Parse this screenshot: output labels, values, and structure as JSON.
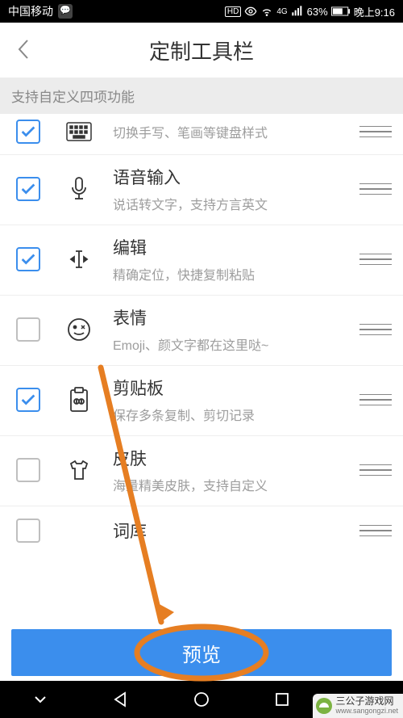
{
  "status": {
    "carrier": "中国移动",
    "hd": "HD",
    "network": "4G",
    "battery": "63%",
    "time": "晚上9:16"
  },
  "header": {
    "title": "定制工具栏"
  },
  "notice": "支持自定义四项功能",
  "items": [
    {
      "title": "",
      "subtitle": "切换手写、笔画等键盘样式",
      "checked": true,
      "icon": "keyboard"
    },
    {
      "title": "语音输入",
      "subtitle": "说话转文字，支持方言英文",
      "checked": true,
      "icon": "mic"
    },
    {
      "title": "编辑",
      "subtitle": "精确定位，快捷复制粘贴",
      "checked": true,
      "icon": "cursor"
    },
    {
      "title": "表情",
      "subtitle": "Emoji、颜文字都在这里哒~",
      "checked": false,
      "icon": "emoji"
    },
    {
      "title": "剪贴板",
      "subtitle": "保存多条复制、剪切记录",
      "checked": true,
      "icon": "clipboard"
    },
    {
      "title": "皮肤",
      "subtitle": "海量精美皮肤，支持自定义",
      "checked": false,
      "icon": "skin"
    },
    {
      "title": "词库",
      "subtitle": "",
      "checked": false,
      "icon": "dict"
    }
  ],
  "preview_button": "预览",
  "watermark": {
    "name": "三公子游戏网",
    "url": "www.sangongzi.net"
  }
}
